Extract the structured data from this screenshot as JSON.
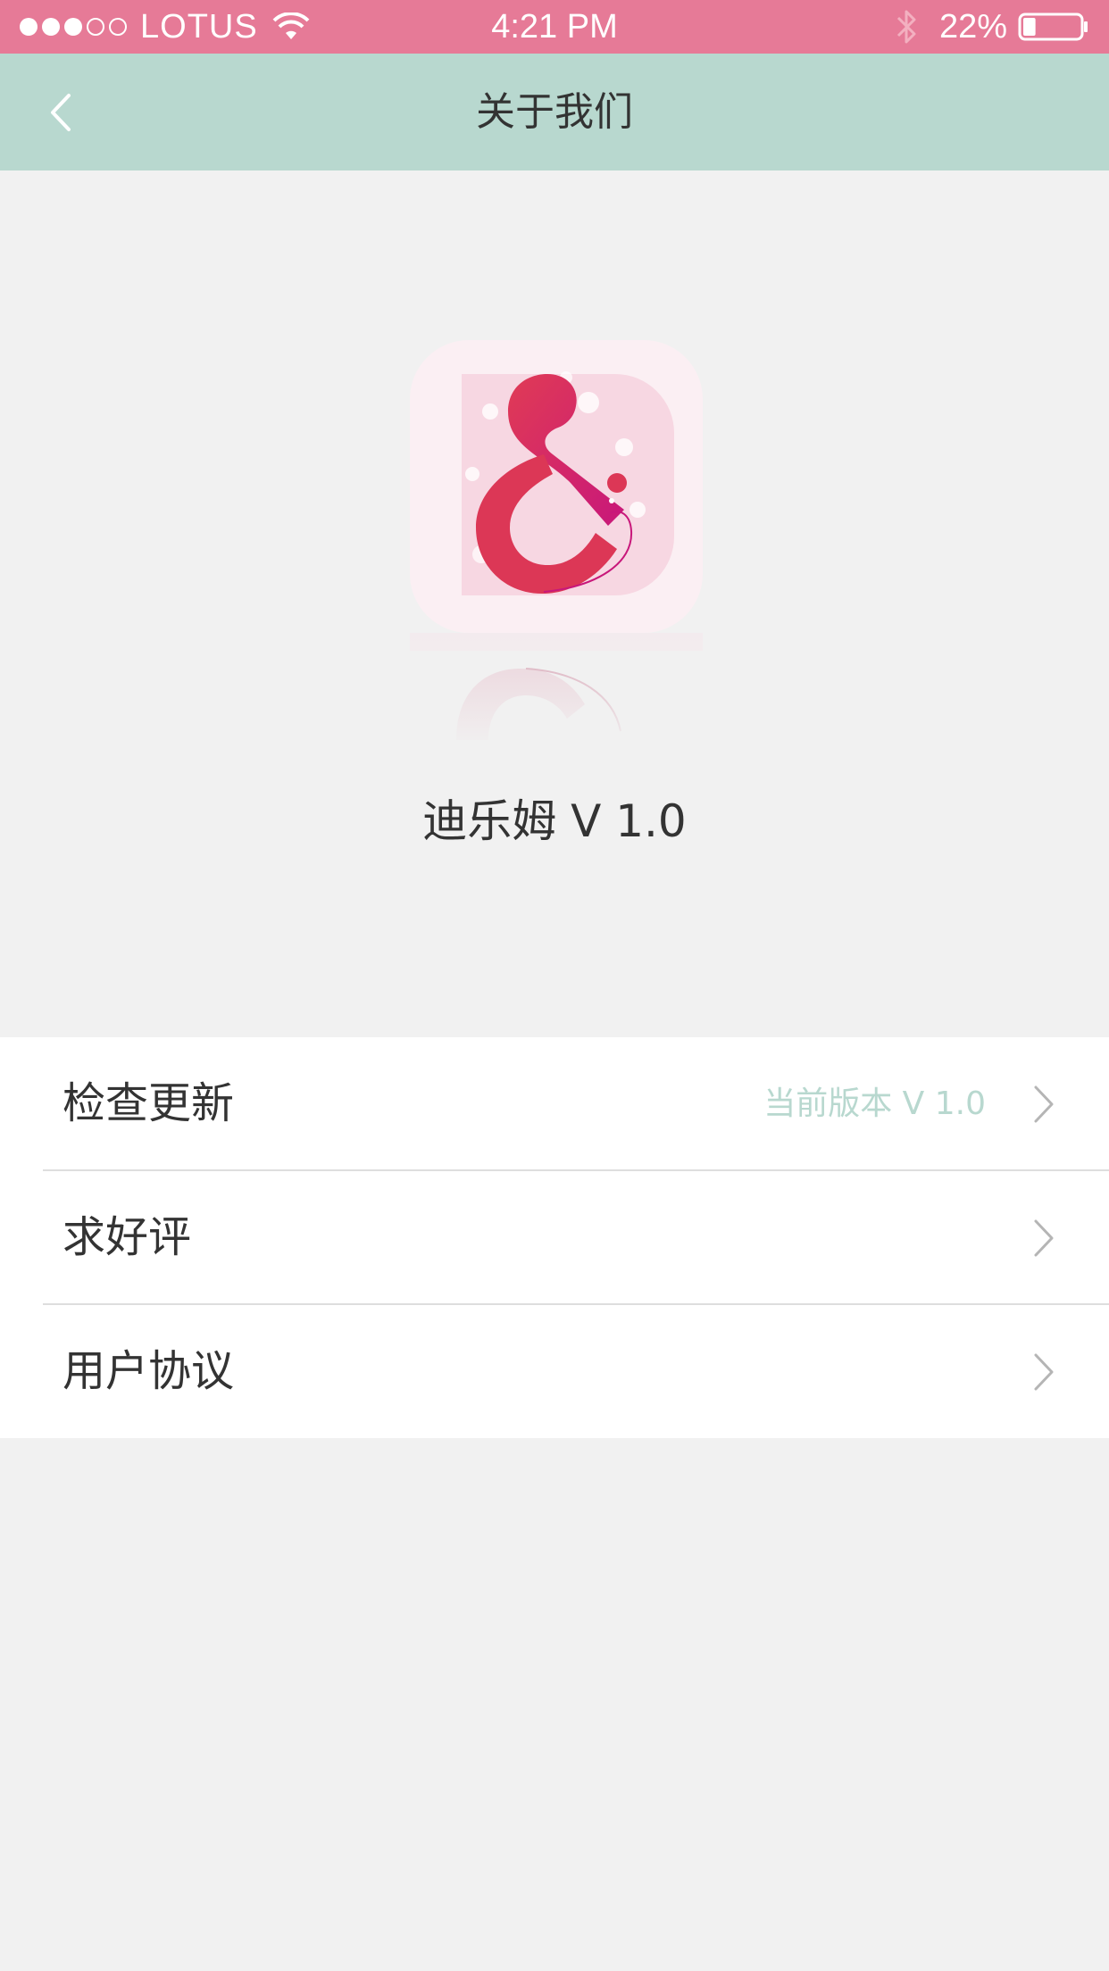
{
  "status_bar": {
    "carrier": "LOTUS",
    "time": "4:21 PM",
    "battery": "22%",
    "signal_bars": 3,
    "battery_level": 0.22,
    "icons": [
      "signal-dots-icon",
      "wifi-icon",
      "bluetooth-icon",
      "battery-icon"
    ]
  },
  "nav": {
    "title": "关于我们",
    "back_icon": "chevron-left-icon"
  },
  "app": {
    "logo_icon": "ampersand-logo-icon",
    "name": "迪乐姆 V 1.0"
  },
  "settings": {
    "rows": [
      {
        "label": "检查更新",
        "value": "当前版本 V 1.0",
        "icon": "chevron-right-icon"
      },
      {
        "label": "求好评",
        "value": "",
        "icon": "chevron-right-icon"
      },
      {
        "label": "用户协议",
        "value": "",
        "icon": "chevron-right-icon"
      }
    ]
  },
  "colors": {
    "status_bar": "#e67a97",
    "nav_bar": "#b8d8cf",
    "page_background": "#f1f1f1",
    "logo_magenta": "#d23a5a",
    "accent_text": "#b8d8cf"
  }
}
